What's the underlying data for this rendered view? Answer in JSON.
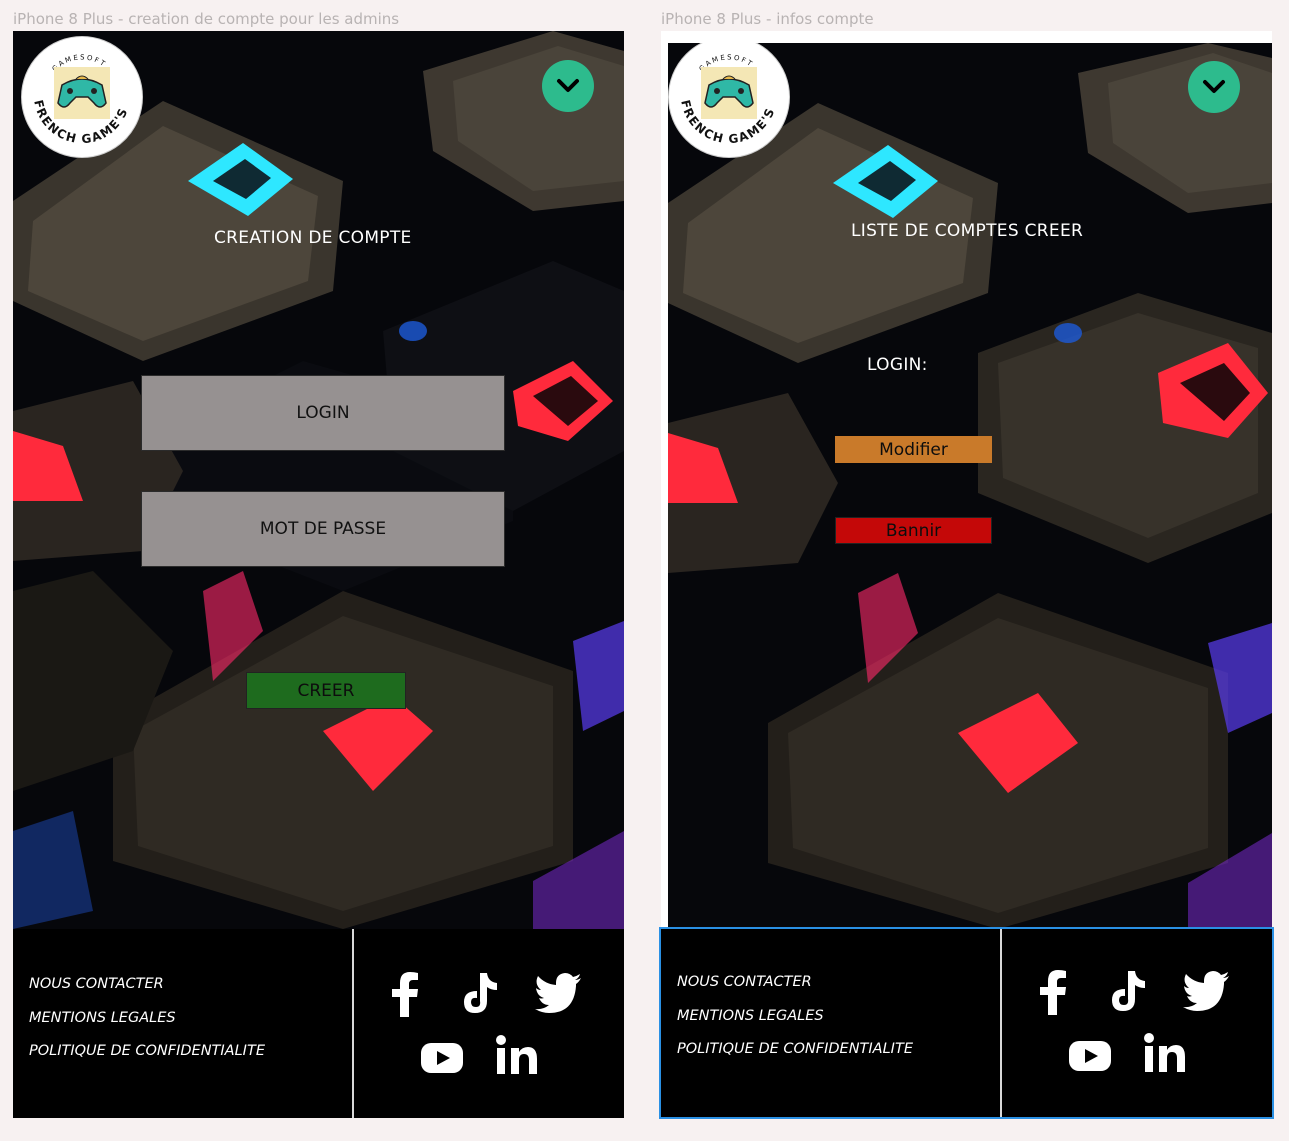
{
  "frames": [
    {
      "label": "iPhone 8 Plus - creation de compte pour les admins",
      "title": "CREATION DE COMPTE",
      "login_field": "LOGIN",
      "password_field": "MOT DE PASSE",
      "create_button": "CREER"
    },
    {
      "label": "iPhone 8 Plus - infos compte",
      "title": "LISTE DE COMPTES CREER",
      "login_label": "LOGIN:",
      "modify_button": "Modifier",
      "ban_button": "Bannir"
    }
  ],
  "logo": {
    "arc_top": "GAMESOFT",
    "arc_bottom": "FRENCH GAME'S"
  },
  "footer": {
    "contact": "NOUS CONTACTER",
    "legal": "MENTIONS LEGALES",
    "privacy": "POLITIQUE DE CONFIDENTIALITE",
    "social_icons": [
      "facebook-icon",
      "tiktok-icon",
      "twitter-icon",
      "youtube-icon",
      "linkedin-icon"
    ]
  },
  "colors": {
    "chevron": "#2dbb8d",
    "field": "#969191",
    "create": "#1e6b1e",
    "modify": "#c97a2a",
    "ban": "#c40808",
    "selection": "#2a90e4"
  }
}
